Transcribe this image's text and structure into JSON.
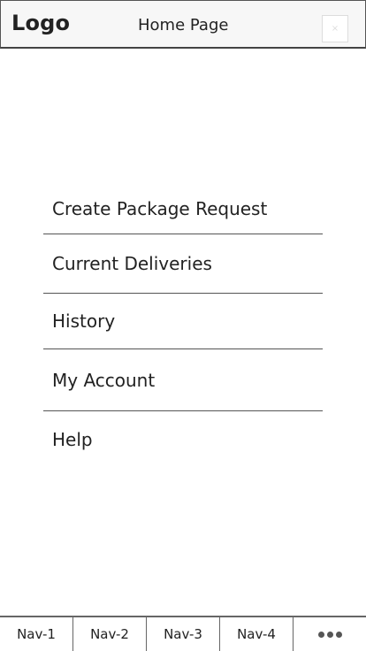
{
  "header": {
    "logo": "Logo",
    "title": "Home Page",
    "close_icon": "×"
  },
  "menu": {
    "items": [
      {
        "label": "Create Package Request"
      },
      {
        "label": "Current Deliveries"
      },
      {
        "label": "History"
      },
      {
        "label": "My Account"
      },
      {
        "label": "Help"
      }
    ]
  },
  "bottom_nav": {
    "items": [
      {
        "label": "Nav-1"
      },
      {
        "label": "Nav-2"
      },
      {
        "label": "Nav-3"
      },
      {
        "label": "Nav-4"
      }
    ],
    "more_icon": "more-dots-icon"
  }
}
